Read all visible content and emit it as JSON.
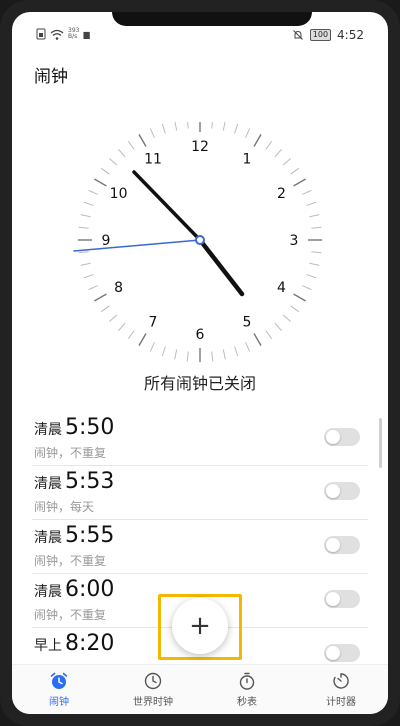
{
  "statusbar": {
    "left_indicator": "▆",
    "rate_top": "393",
    "rate_bottom": "B/s",
    "battery": "100",
    "time": "4:52"
  },
  "app": {
    "title": "闹钟"
  },
  "clock": {
    "numbers": [
      "12",
      "1",
      "2",
      "3",
      "4",
      "5",
      "6",
      "7",
      "8",
      "9",
      "10",
      "11"
    ],
    "time_shown": "4:52",
    "hour_hand_color": "#111111",
    "second_hand_color": "#3a66d8"
  },
  "status_message": "所有闹钟已关闭",
  "alarms": [
    {
      "period": "清晨",
      "time": "5:50",
      "desc": "闹钟，不重复",
      "enabled": false
    },
    {
      "period": "清晨",
      "time": "5:53",
      "desc": "闹钟，每天",
      "enabled": false
    },
    {
      "period": "清晨",
      "time": "5:55",
      "desc": "闹钟，不重复",
      "enabled": false
    },
    {
      "period": "清晨",
      "time": "6:00",
      "desc": "闹钟，不重复",
      "enabled": false
    },
    {
      "period": "早上",
      "time": "8:20",
      "desc": "",
      "enabled": false
    }
  ],
  "fab": {
    "label": "+"
  },
  "nav": [
    {
      "label": "闹钟",
      "icon": "alarm-clock-icon",
      "active": true
    },
    {
      "label": "世界时钟",
      "icon": "world-clock-icon",
      "active": false
    },
    {
      "label": "秒表",
      "icon": "stopwatch-icon",
      "active": false
    },
    {
      "label": "计时器",
      "icon": "timer-icon",
      "active": false
    }
  ],
  "colors": {
    "accent": "#2a6cf2",
    "highlight": "#f5b800"
  }
}
